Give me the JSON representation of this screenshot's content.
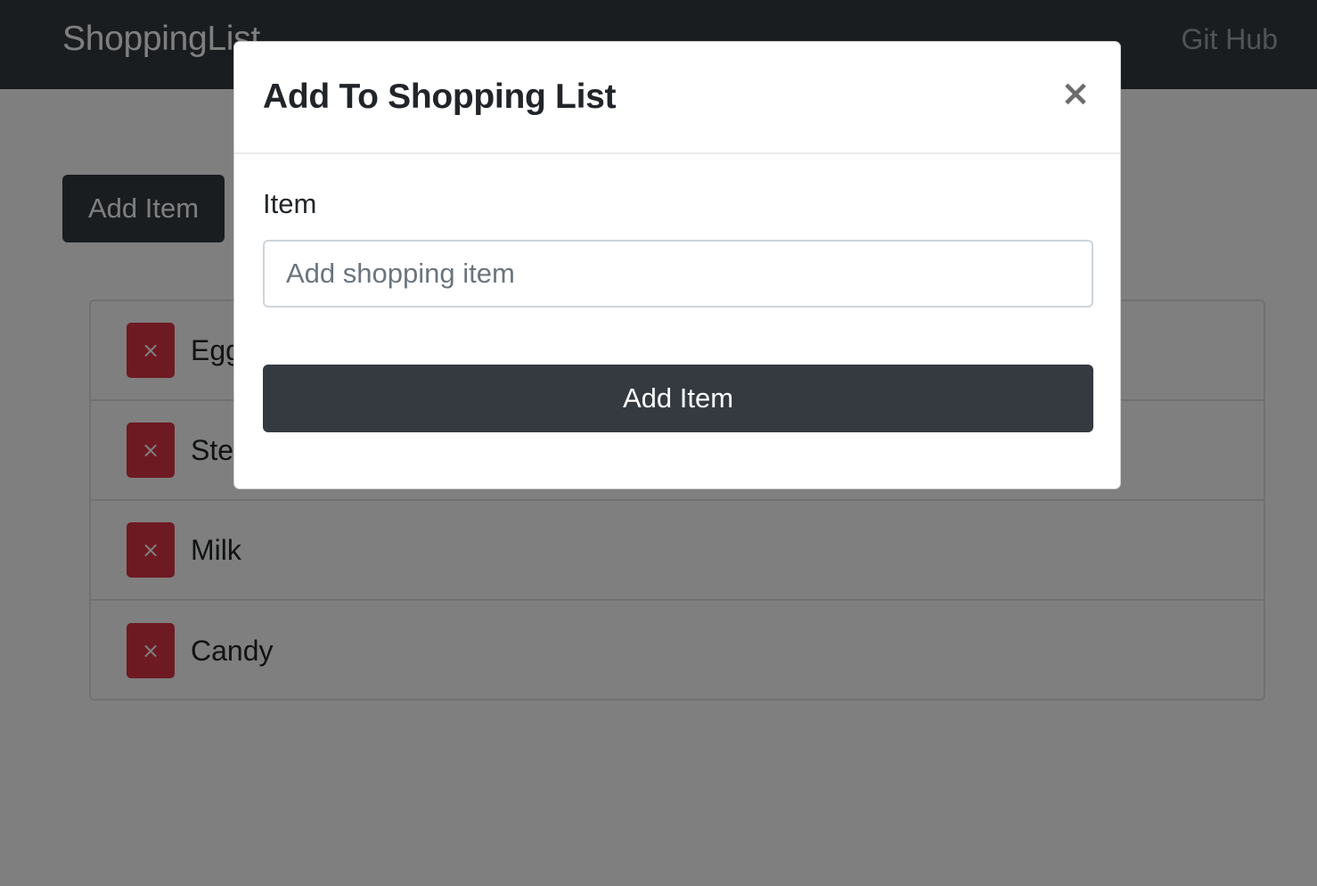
{
  "navbar": {
    "brand": "ShoppingList",
    "link": "Git Hub"
  },
  "main": {
    "add_button_label": "Add Item",
    "items": [
      {
        "name": "Eggs",
        "remove_label": "×"
      },
      {
        "name": "Steak",
        "remove_label": "×"
      },
      {
        "name": "Milk",
        "remove_label": "×"
      },
      {
        "name": "Candy",
        "remove_label": "×"
      }
    ]
  },
  "modal": {
    "title": "Add To Shopping List",
    "close_label": "×",
    "field_label": "Item",
    "input_placeholder": "Add shopping item",
    "input_value": "",
    "submit_label": "Add Item"
  },
  "colors": {
    "navbar": "#343a40",
    "danger": "#dc3545",
    "dark_button": "#343a40"
  }
}
